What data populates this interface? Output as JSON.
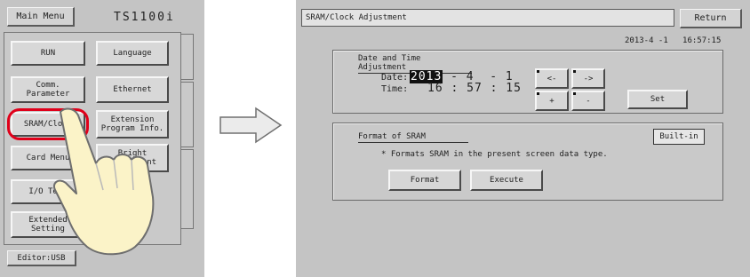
{
  "left_screen": {
    "main_menu_label": "Main Menu",
    "model_name": "TS1100i",
    "buttons": {
      "run": "RUN",
      "language": "Language",
      "comm_parameter": "Comm.\nParameter",
      "ethernet": "Ethernet",
      "sram_clock": "SRAM/Clock",
      "extension_program_info": "Extension\nProgram Info.",
      "card_menu": "Card Menu",
      "brightness_adjustment": "Bright\nAdjustment",
      "io_test": "I/O Test",
      "extended_setting": "Extended\nSetting"
    },
    "editor_label": "Editor:USB"
  },
  "right_screen": {
    "title": "SRAM/Clock Adjustment",
    "return_label": "Return",
    "current_datetime": "2013-4 -1   16:57:15",
    "date_time_group": {
      "title": "Date and Time Adjustment",
      "date_label": "Date:",
      "date_year": "2013",
      "date_rest": " - 4  - 1",
      "time_label": "Time:",
      "time_value": "16 : 57 : 15",
      "left_btn": "<-",
      "right_btn": "->",
      "plus_btn": "+",
      "minus_btn": "-",
      "set_btn": "Set"
    },
    "sram_group": {
      "title": "Format of SRAM",
      "builtin_label": "Built-in",
      "description": "* Formats SRAM in the present screen data type.",
      "format_btn": "Format",
      "execute_btn": "Execute"
    }
  },
  "colors": {
    "panel_gray": "#c4c4c4",
    "highlight_red": "#e0001a"
  }
}
